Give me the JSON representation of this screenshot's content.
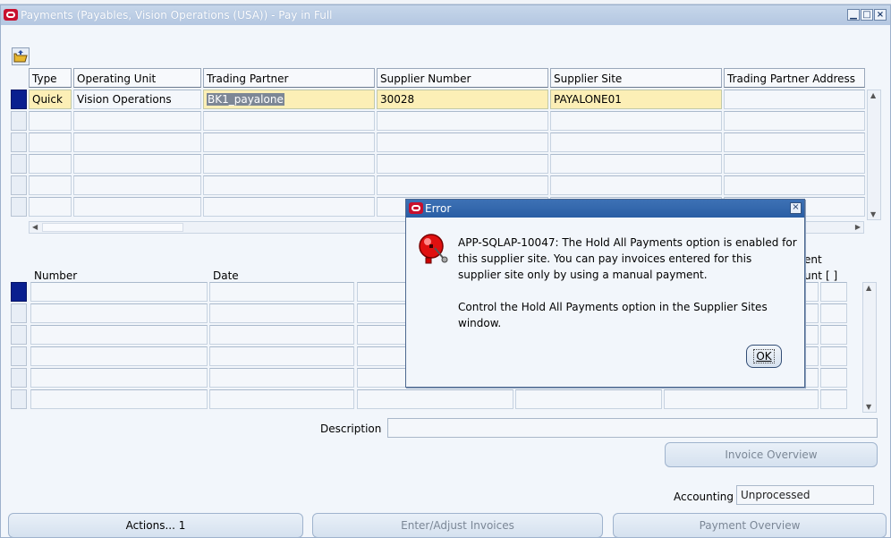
{
  "window": {
    "title": "Payments (Payables, Vision Operations (USA)) - Pay in Full",
    "min_symbol": "▁",
    "max_symbol": "□",
    "close_symbol": "×"
  },
  "top_grid": {
    "headers": [
      "Type",
      "Operating Unit",
      "Trading Partner",
      "Supplier Number",
      "Supplier Site",
      "Trading Partner Address"
    ],
    "rows": [
      {
        "type": "Quick",
        "operating_unit": "Vision Operations",
        "trading_partner": "BK1_payalone",
        "supplier_number": "30028",
        "supplier_site": "PAYALONE01",
        "address": ""
      }
    ]
  },
  "bottom_grid": {
    "headers": [
      "Number",
      "Date"
    ],
    "right_header_fragments": [
      "ent",
      "unt",
      "[ ]"
    ]
  },
  "description_label": "Description",
  "description_value": "",
  "invoice_overview_label": "Invoice Overview",
  "accounting_label": "Accounting",
  "accounting_value": "Unprocessed",
  "buttons": {
    "actions": "Actions... 1",
    "enter_adjust": "Enter/Adjust Invoices",
    "payment_overview": "Payment Overview"
  },
  "dialog": {
    "title": "Error",
    "lines": [
      "APP-SQLAP-10047: The Hold All Payments option is enabled for",
      "this supplier site.  You can pay invoices entered for this",
      "supplier site only by using a manual payment.",
      "Control the Hold All Payments option in the Supplier Sites",
      "window."
    ],
    "ok_label": "OK",
    "icon": "alarm-bell-icon"
  },
  "colors": {
    "current_row_marker": "#0a1f8f",
    "active_row": "#fcefb6",
    "dialog_title_bg": "#2a5ea4",
    "oracle_red": "#c8102e"
  }
}
